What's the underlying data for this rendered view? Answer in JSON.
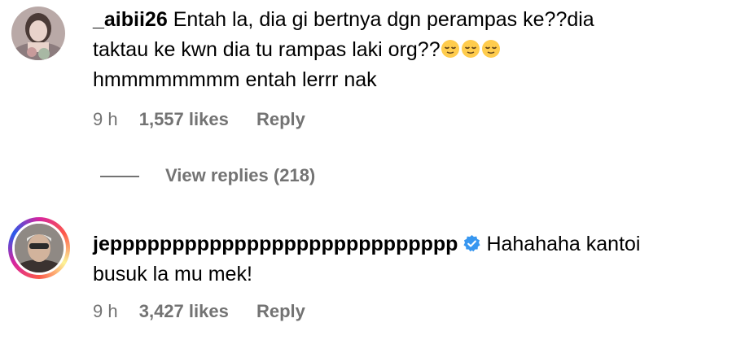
{
  "comments": [
    {
      "username": "_aibii26",
      "text_line1": "Entah la, dia gi bertnya dgn perampas ke??dia",
      "text_line2": "taktau ke kwn dia tu rampas laki org??",
      "emojis": [
        "relieved-face-icon",
        "relieved-face-icon",
        "relieved-face-icon"
      ],
      "text_line3": "hmmmmmmmm entah lerrr nak",
      "time": "9 h",
      "likes": "1,557 likes",
      "reply_label": "Reply",
      "view_replies": "View replies (218)"
    },
    {
      "username": "jepppppppppppppppppppppppppppp",
      "verified": true,
      "text_line1": "Hahahaha kantoi",
      "text_line2": "busuk la mu mek!",
      "time": "9 h",
      "likes": "3,427 likes",
      "reply_label": "Reply"
    }
  ],
  "colors": {
    "meta_gray": "#737373",
    "verified_blue": "#3897f0"
  }
}
